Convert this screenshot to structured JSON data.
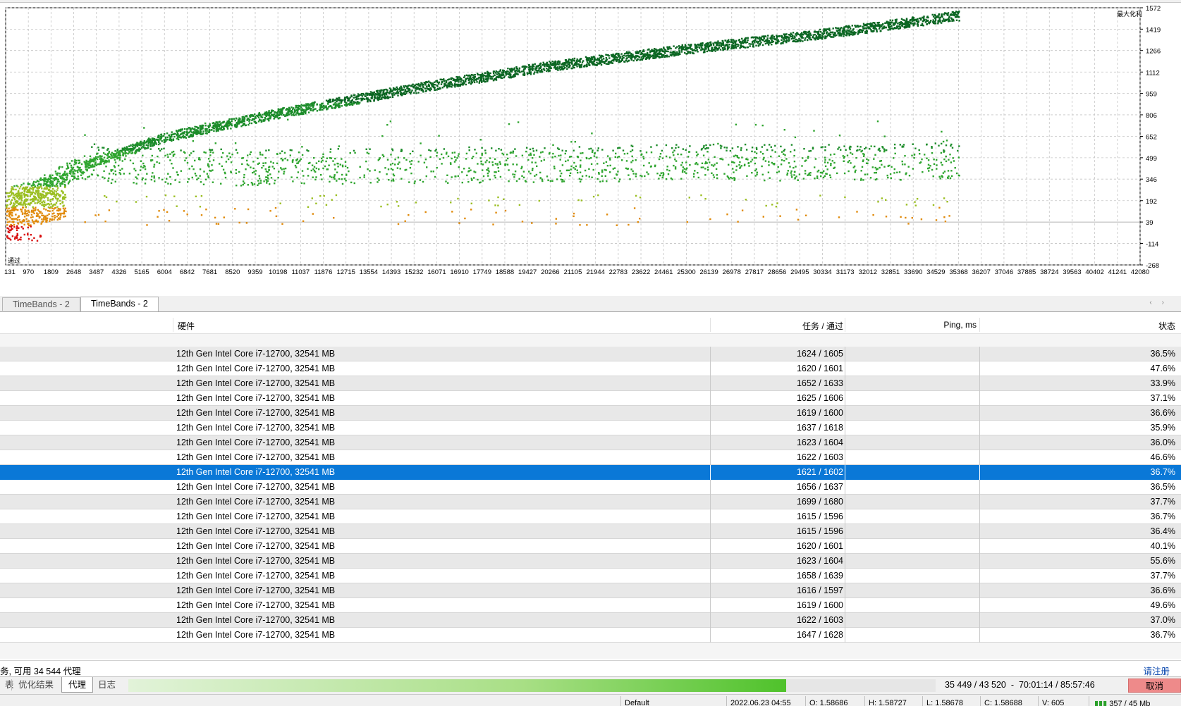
{
  "chart": {
    "legend_top": "最大化利",
    "legend_bottom": "通过",
    "y_ticks": [
      "1572",
      "1419",
      "1266",
      "1112",
      "959",
      "806",
      "652",
      "499",
      "346",
      "192",
      "39",
      "-114",
      "-268"
    ],
    "x_ticks": [
      "131",
      "970",
      "1809",
      "2648",
      "3487",
      "4326",
      "5165",
      "6004",
      "6842",
      "7681",
      "8520",
      "9359",
      "10198",
      "11037",
      "11876",
      "12715",
      "13554",
      "14393",
      "15232",
      "16071",
      "16910",
      "17749",
      "18588",
      "19427",
      "20266",
      "21105",
      "21944",
      "22783",
      "23622",
      "24461",
      "25300",
      "26139",
      "26978",
      "27817",
      "28656",
      "29495",
      "30334",
      "31173",
      "32012",
      "32851",
      "33690",
      "34529",
      "35368",
      "36207",
      "37046",
      "37885",
      "38724",
      "39563",
      "40402",
      "41241",
      "42080"
    ],
    "colors": {
      "dark_green": "#0b6622",
      "mid_green": "#1c8c2a",
      "light_green": "#2fa52f",
      "yellow_green": "#9bbf22",
      "orange": "#e08a0a",
      "red": "#d81010"
    }
  },
  "chart_data": {
    "type": "scatter",
    "title": "",
    "xlabel": "",
    "ylabel": "",
    "xlim": [
      131,
      42080
    ],
    "ylim": [
      -268,
      1572
    ],
    "grid": true,
    "series": [
      {
        "name": "",
        "description_points": [
          [
            131,
            150
          ],
          [
            2648,
            420
          ],
          [
            6004,
            650
          ],
          [
            10198,
            820
          ],
          [
            15232,
            1000
          ],
          [
            20266,
            1160
          ],
          [
            25300,
            1280
          ],
          [
            30334,
            1390
          ],
          [
            35368,
            1520
          ]
        ]
      },
      {
        "name": "",
        "description_points": [
          [
            3487,
            450
          ],
          [
            10198,
            430
          ],
          [
            15232,
            450
          ],
          [
            20266,
            460
          ],
          [
            25300,
            470
          ],
          [
            30334,
            470
          ],
          [
            35368,
            480
          ]
        ]
      }
    ]
  },
  "chart_tabs": [
    {
      "label": "TimeBands - 2",
      "active": false
    },
    {
      "label": "TimeBands - 2",
      "active": true
    }
  ],
  "table": {
    "headers": {
      "hardware": "硬件",
      "tasks": "任务 / 通过",
      "ping": "Ping, ms",
      "status": "状态"
    },
    "rows": [
      {
        "hw": "12th Gen Intel Core i7-12700, 32541 MB",
        "tasks": "1624 / 1605",
        "status": "36.5%"
      },
      {
        "hw": "12th Gen Intel Core i7-12700, 32541 MB",
        "tasks": "1620 / 1601",
        "status": "47.6%"
      },
      {
        "hw": "12th Gen Intel Core i7-12700, 32541 MB",
        "tasks": "1652 / 1633",
        "status": "33.9%"
      },
      {
        "hw": "12th Gen Intel Core i7-12700, 32541 MB",
        "tasks": "1625 / 1606",
        "status": "37.1%"
      },
      {
        "hw": "12th Gen Intel Core i7-12700, 32541 MB",
        "tasks": "1619 / 1600",
        "status": "36.6%"
      },
      {
        "hw": "12th Gen Intel Core i7-12700, 32541 MB",
        "tasks": "1637 / 1618",
        "status": "35.9%"
      },
      {
        "hw": "12th Gen Intel Core i7-12700, 32541 MB",
        "tasks": "1623 / 1604",
        "status": "36.0%"
      },
      {
        "hw": "12th Gen Intel Core i7-12700, 32541 MB",
        "tasks": "1622 / 1603",
        "status": "46.6%"
      },
      {
        "hw": "12th Gen Intel Core i7-12700, 32541 MB",
        "tasks": "1621 / 1602",
        "status": "36.7%",
        "selected": true
      },
      {
        "hw": "12th Gen Intel Core i7-12700, 32541 MB",
        "tasks": "1656 / 1637",
        "status": "36.5%"
      },
      {
        "hw": "12th Gen Intel Core i7-12700, 32541 MB",
        "tasks": "1699 / 1680",
        "status": "37.7%"
      },
      {
        "hw": "12th Gen Intel Core i7-12700, 32541 MB",
        "tasks": "1615 / 1596",
        "status": "36.7%"
      },
      {
        "hw": "12th Gen Intel Core i7-12700, 32541 MB",
        "tasks": "1615 / 1596",
        "status": "36.4%"
      },
      {
        "hw": "12th Gen Intel Core i7-12700, 32541 MB",
        "tasks": "1620 / 1601",
        "status": "40.1%"
      },
      {
        "hw": "12th Gen Intel Core i7-12700, 32541 MB",
        "tasks": "1623 / 1604",
        "status": "55.6%"
      },
      {
        "hw": "12th Gen Intel Core i7-12700, 32541 MB",
        "tasks": "1658 / 1639",
        "status": "37.7%"
      },
      {
        "hw": "12th Gen Intel Core i7-12700, 32541 MB",
        "tasks": "1616 / 1597",
        "status": "36.6%"
      },
      {
        "hw": "12th Gen Intel Core i7-12700, 32541 MB",
        "tasks": "1619 / 1600",
        "status": "49.6%"
      },
      {
        "hw": "12th Gen Intel Core i7-12700, 32541 MB",
        "tasks": "1622 / 1603",
        "status": "37.0%"
      },
      {
        "hw": "12th Gen Intel Core i7-12700, 32541 MB",
        "tasks": "1647 / 1628",
        "status": "36.7%"
      }
    ]
  },
  "status_line": {
    "text": "务, 可用 34 544 代理",
    "register_link": "请注册"
  },
  "bottom_tabs": [
    {
      "label": "表",
      "active": false
    },
    {
      "label": "优化结果",
      "active": false
    },
    {
      "label": "代理",
      "active": true
    },
    {
      "label": "日志",
      "active": false
    }
  ],
  "progress": {
    "done": 35449,
    "total": 43520,
    "text": "35 449 / 43 520  -  70:01:14 / 85:57:46",
    "cancel_label": "取消"
  },
  "statusbar": {
    "profile": "Default",
    "datetime": "2022.06.23 04:55",
    "open": "O: 1.58686",
    "high": "H: 1.58727",
    "low": "L: 1.58678",
    "close": "C: 1.58688",
    "volume": "V: 605",
    "traffic": "357 / 45 Mb"
  }
}
